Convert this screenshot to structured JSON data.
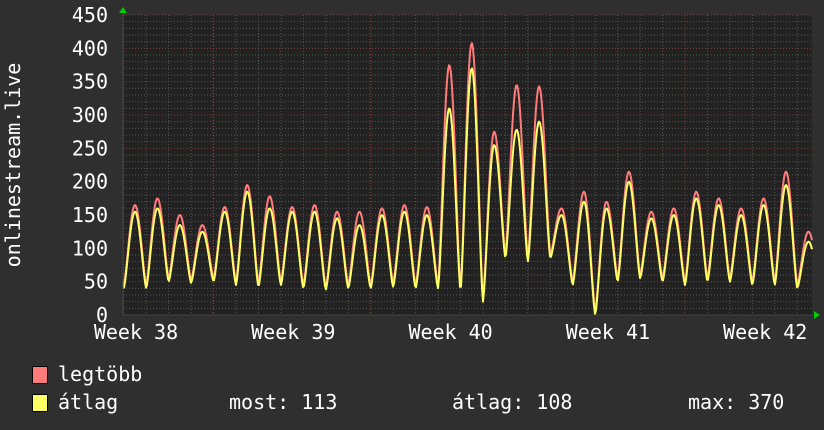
{
  "chart_data": {
    "type": "line",
    "ylabel": "onlinestream.live",
    "ylim": [
      0,
      450
    ],
    "yticks": [
      0,
      50,
      100,
      150,
      200,
      250,
      300,
      350,
      400,
      450
    ],
    "xtick_labels": [
      "Week 38",
      "Week 39",
      "Week 40",
      "Week 41",
      "Week 42"
    ],
    "grid": true,
    "x_unit": "day",
    "series": [
      {
        "name": "legtöbb",
        "color": "#ff7b7b",
        "daily_peaks": [
          165,
          175,
          150,
          135,
          162,
          195,
          178,
          162,
          165,
          155,
          155,
          160,
          165,
          162,
          375,
          408,
          275,
          345,
          343,
          160,
          185,
          170,
          215,
          155,
          160,
          185,
          175,
          160,
          175,
          215,
          125
        ],
        "daily_troughs": [
          45,
          55,
          52,
          55,
          50,
          48,
          50,
          45,
          42,
          45,
          45,
          48,
          45,
          45,
          40,
          25,
          90,
          85,
          90,
          50,
          5,
          55,
          60,
          55,
          50,
          55,
          55,
          50,
          50,
          45,
          45
        ]
      },
      {
        "name": "átlag",
        "color": "#ffff66",
        "daily_peaks": [
          155,
          160,
          135,
          125,
          155,
          185,
          160,
          155,
          155,
          145,
          135,
          150,
          155,
          150,
          310,
          370,
          255,
          278,
          290,
          150,
          170,
          160,
          200,
          145,
          150,
          175,
          165,
          150,
          165,
          195,
          110
        ],
        "daily_troughs": [
          40,
          50,
          48,
          50,
          45,
          42,
          45,
          40,
          38,
          40,
          40,
          42,
          40,
          40,
          35,
          20,
          85,
          80,
          85,
          45,
          0,
          50,
          55,
          50,
          45,
          50,
          50,
          45,
          45,
          40,
          40
        ]
      }
    ]
  },
  "legend": {
    "items": [
      {
        "label": "legtöbb",
        "color": "#ff7b7b"
      },
      {
        "label": "átlag",
        "color": "#ffff66"
      }
    ],
    "stats": {
      "current": "most: 113",
      "average": "átlag: 108",
      "max": "max: 370"
    }
  }
}
